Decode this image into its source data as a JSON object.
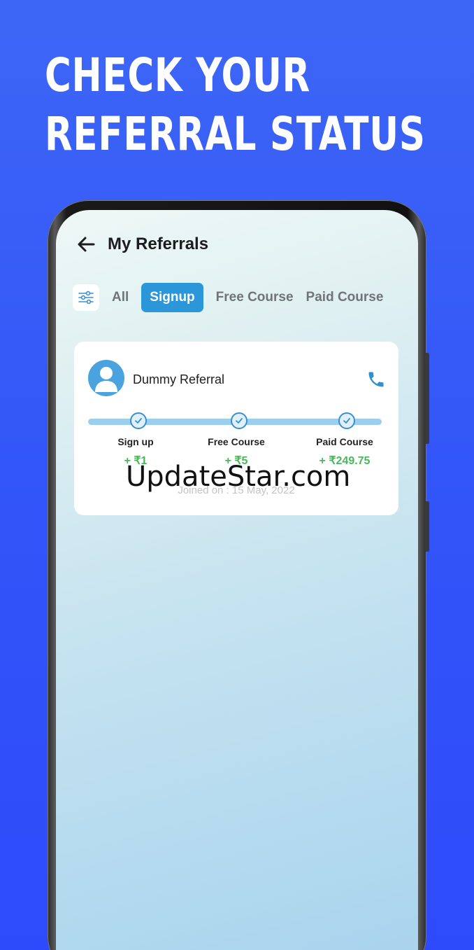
{
  "headline": {
    "line1": "CHECK YOUR",
    "line2": "REFERRAL STATUS"
  },
  "app": {
    "title": "My Referrals",
    "tabs": [
      {
        "label": "All",
        "active": false
      },
      {
        "label": "Signup",
        "active": true
      },
      {
        "label": "Free Course",
        "active": false
      },
      {
        "label": "Paid Course",
        "active": false
      }
    ],
    "referral": {
      "name": "Dummy Referral",
      "steps": [
        {
          "label": "Sign up",
          "amount": "+ ₹1",
          "completed": true
        },
        {
          "label": "Free Course",
          "amount": "+ ₹5",
          "completed": true
        },
        {
          "label": "Paid Course",
          "amount": "+ ₹249.75",
          "completed": true
        }
      ],
      "joined": "Joined on : 15 May, 2022"
    }
  },
  "watermark": "UpdateStar.com",
  "icons": [
    "back-arrow-icon",
    "filter-icon",
    "avatar-icon",
    "phone-call-icon",
    "check-icon"
  ],
  "colors": {
    "background": "#3254f8",
    "accent": "#2c97d8",
    "amount_green": "#47b85a",
    "progress_track": "#9ccfee"
  }
}
